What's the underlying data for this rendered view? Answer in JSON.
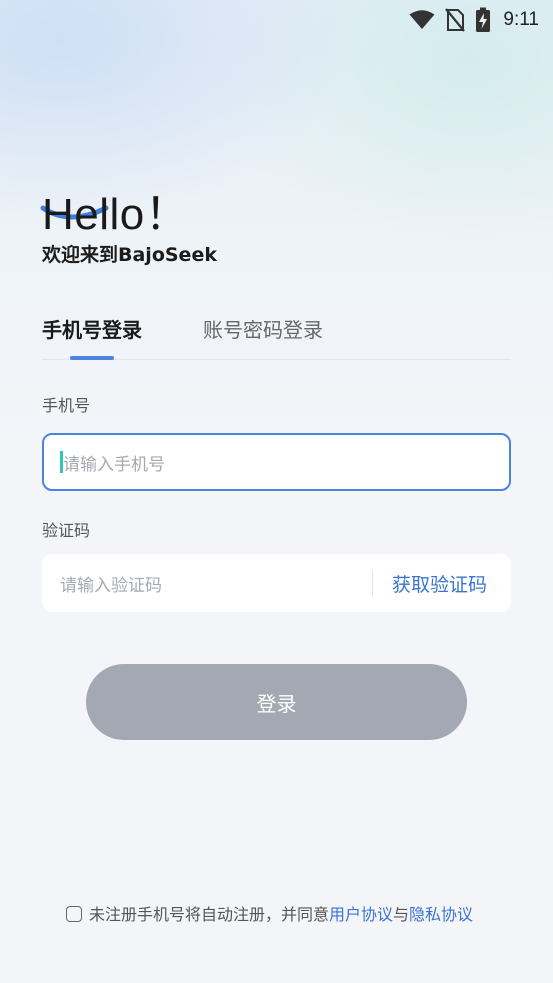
{
  "status_bar": {
    "time": "9:11",
    "icons": [
      "wifi-icon",
      "no-sim-icon",
      "battery-charging-icon"
    ]
  },
  "header": {
    "hello": "Hello！",
    "welcome": "欢迎来到BajoSeek"
  },
  "tabs": [
    {
      "label": "手机号登录",
      "active": true
    },
    {
      "label": "账号密码登录",
      "active": false
    }
  ],
  "form": {
    "phone_label": "手机号",
    "phone_placeholder": "请输入手机号",
    "phone_value": "",
    "code_label": "验证码",
    "code_placeholder": "请输入验证码",
    "code_value": "",
    "get_code_label": "获取验证码",
    "submit_label": "登录"
  },
  "agreement": {
    "prefix": "未注册手机号将自动注册，并同意",
    "user_agreement": "用户协议",
    "and": "与",
    "privacy_policy": "隐私协议",
    "checked": false
  },
  "colors": {
    "accent": "#4a83e0",
    "link": "#3a74cf",
    "caret": "#2fc7b6",
    "button_disabled": "#a4a8b3"
  }
}
